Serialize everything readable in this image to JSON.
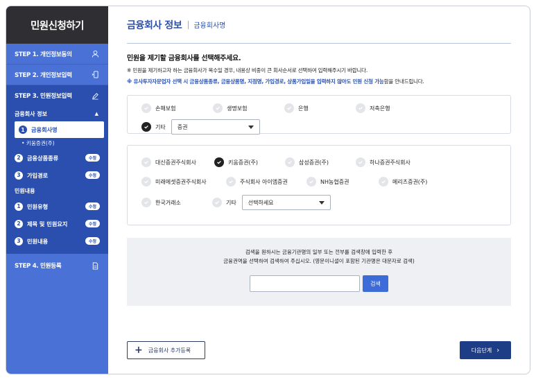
{
  "sidebar": {
    "title": "민원신청하기",
    "step1": "STEP 1. 개인정보동의",
    "step2": "STEP 2. 개인정보입력",
    "step3": "STEP 3. 민원정보입력",
    "step4": "STEP 4. 민원등록",
    "group1": "금융회사 정보",
    "items1": [
      {
        "num": "1",
        "label": "금융회사명",
        "tag": ""
      },
      {
        "num": "2",
        "label": "금융상품종류",
        "tag": "수정"
      },
      {
        "num": "3",
        "label": "가입경로",
        "tag": "수정"
      }
    ],
    "sub_bullet": "• 키움증권(주)",
    "group2": "민원내용",
    "items2": [
      {
        "num": "1",
        "label": "민원유형",
        "tag": "수정"
      },
      {
        "num": "2",
        "label": "제목 및 민원요지",
        "tag": "수정"
      },
      {
        "num": "3",
        "label": "민원내용",
        "tag": "수정"
      }
    ]
  },
  "main": {
    "title": "금융회사 정보",
    "subtitle": "금융회사명",
    "question": "민원을 제기할 금융회사를 선택해주세요.",
    "note1": "※ 민원을 제기하고자 하는 금융회사가 복수일 경우, 내용상 비중이 큰 회사순서로 선택하여 입력해주시기 바랍니다.",
    "note2_blue": "※ 유사투자자문업자 선택 시 금융상품종류, 금융상품명, 지점명, 가입경로, 상품가입일을 입력하지 않아도 민원 신청 가능",
    "note2_plain": "함을 안내드립니다.",
    "categories": [
      "손해보험",
      "생명보험",
      "은행",
      "저축은행"
    ],
    "category_other": "기타",
    "category_select": "증권",
    "companies_row1": [
      "대신증권주식회사",
      "키움증권(주)",
      "삼성증권(주)",
      "하나증권주식회사"
    ],
    "companies_row2": [
      "미래에셋증권주식회사",
      "주식회사 아이엠증권",
      "NH농협증권",
      "메리츠증권(주)"
    ],
    "companies_row3": [
      "한국거래소"
    ],
    "company_other": "기타",
    "company_select_placeholder": "선택하세요",
    "search_text1": "검색을 원하시는 금융기관명의 일부 또는 전부를 검색창에 입력한 후",
    "search_text2": "금융권역을 선택하여 검색하여 주십시오. (영문이니셜이 포함된 기관명은 대문자로 검색)",
    "search_button": "검색",
    "add_button": "금융회사 추가등록",
    "next_button": "다음단계"
  }
}
